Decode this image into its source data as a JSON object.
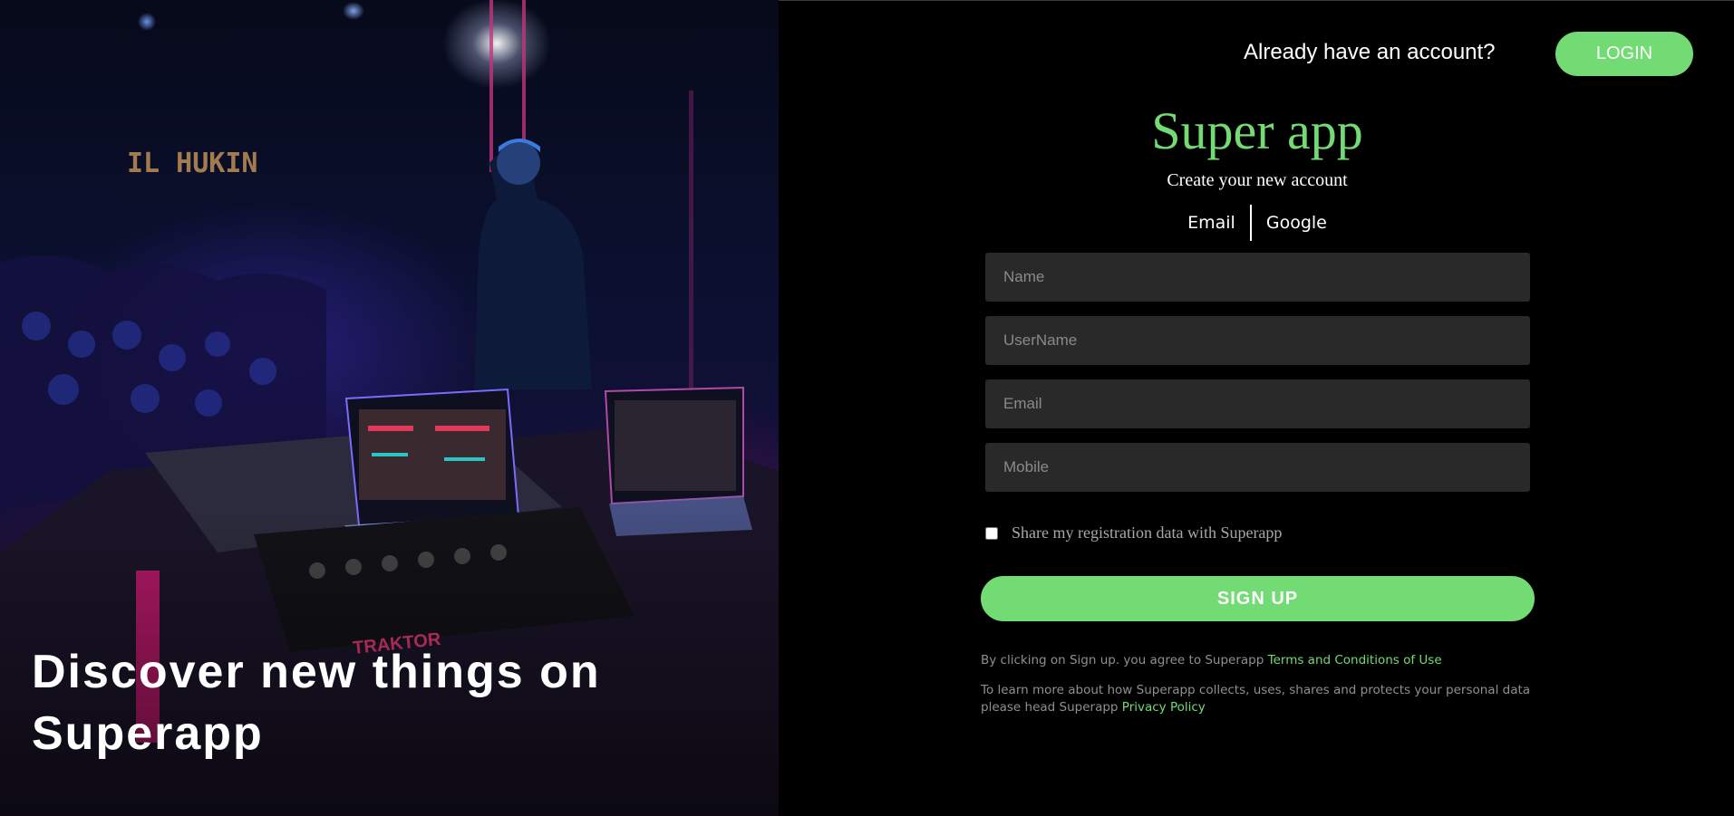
{
  "hero": {
    "title": "Discover new things on Superapp"
  },
  "header": {
    "already_have_account": "Already have an account?",
    "login_label": "LOGIN"
  },
  "brand": {
    "name": "Super app",
    "subtitle": "Create your new account"
  },
  "signup_methods": {
    "email_label": "Email",
    "google_label": "Google"
  },
  "form": {
    "name_placeholder": "Name",
    "username_placeholder": "UserName",
    "email_placeholder": "Email",
    "mobile_placeholder": "Mobile",
    "share_data_label": "Share my registration data with Superapp",
    "share_data_checked": false,
    "signup_label": "SIGN UP"
  },
  "legal": {
    "terms_prefix": "By clicking on Sign up. you agree to Superapp",
    "terms_link": "Terms and Conditions of Use",
    "privacy_prefix": "To learn more about how Superapp collects, uses, shares and protects your personal data please head Superapp",
    "privacy_link": "Privacy Policy"
  },
  "colors": {
    "accent": "#72db73",
    "background": "#000000",
    "field_background": "#292929",
    "muted_text": "#8f8f8f"
  }
}
